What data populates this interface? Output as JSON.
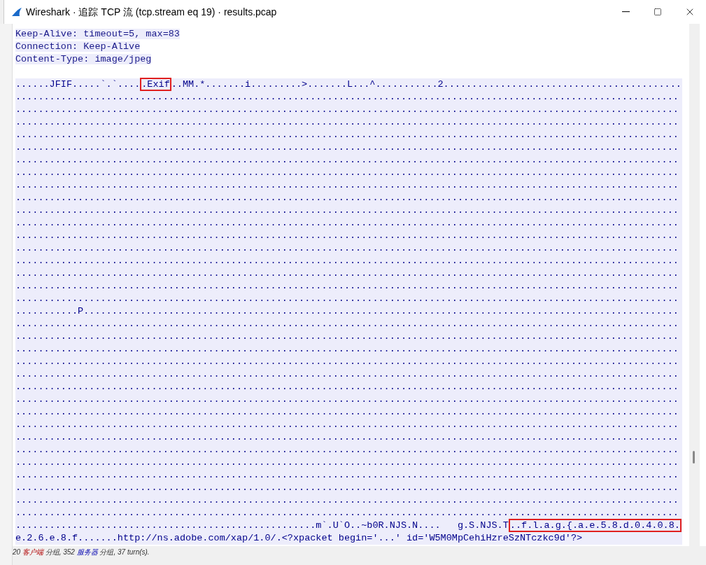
{
  "window": {
    "title": "Wireshark · 追踪 TCP 流 (tcp.stream eq 19) · results.pcap"
  },
  "header_lines": [
    "Keep-Alive: timeout=5, max=83",
    "Connection: Keep-Alive",
    "Content-Type: image/jpeg"
  ],
  "data_lines": [
    {
      "segments": [
        {
          "text": "......JFIF.....`.`....",
          "boxed": false
        },
        {
          "text": ".Exif",
          "boxed": true
        },
        {
          "text": "..MM.*.......i.........>.......L...^...........2..........................................",
          "boxed": false
        }
      ]
    },
    {
      "segments": [
        {
          "text": ".....................................................................................................................",
          "boxed": false
        }
      ]
    },
    {
      "segments": [
        {
          "text": ".....................................................................................................................",
          "boxed": false
        }
      ]
    },
    {
      "segments": [
        {
          "text": ".....................................................................................................................",
          "boxed": false
        }
      ]
    },
    {
      "segments": [
        {
          "text": ".....................................................................................................................",
          "boxed": false
        }
      ]
    },
    {
      "segments": [
        {
          "text": ".....................................................................................................................",
          "boxed": false
        }
      ]
    },
    {
      "segments": [
        {
          "text": ".....................................................................................................................",
          "boxed": false
        }
      ]
    },
    {
      "segments": [
        {
          "text": ".....................................................................................................................",
          "boxed": false
        }
      ]
    },
    {
      "segments": [
        {
          "text": ".....................................................................................................................",
          "boxed": false
        }
      ]
    },
    {
      "segments": [
        {
          "text": ".....................................................................................................................",
          "boxed": false
        }
      ]
    },
    {
      "segments": [
        {
          "text": ".....................................................................................................................",
          "boxed": false
        }
      ]
    },
    {
      "segments": [
        {
          "text": ".....................................................................................................................",
          "boxed": false
        }
      ]
    },
    {
      "segments": [
        {
          "text": ".....................................................................................................................",
          "boxed": false
        }
      ]
    },
    {
      "segments": [
        {
          "text": ".....................................................................................................................",
          "boxed": false
        }
      ]
    },
    {
      "segments": [
        {
          "text": ".....................................................................................................................",
          "boxed": false
        }
      ]
    },
    {
      "segments": [
        {
          "text": ".....................................................................................................................",
          "boxed": false
        }
      ]
    },
    {
      "segments": [
        {
          "text": ".....................................................................................................................",
          "boxed": false
        }
      ]
    },
    {
      "segments": [
        {
          "text": ".....................................................................................................................",
          "boxed": false
        }
      ]
    },
    {
      "segments": [
        {
          "text": "...........P.........................................................................................................",
          "boxed": false
        }
      ]
    },
    {
      "segments": [
        {
          "text": ".....................................................................................................................",
          "boxed": false
        }
      ]
    },
    {
      "segments": [
        {
          "text": ".....................................................................................................................",
          "boxed": false
        }
      ]
    },
    {
      "segments": [
        {
          "text": ".....................................................................................................................",
          "boxed": false
        }
      ]
    },
    {
      "segments": [
        {
          "text": ".....................................................................................................................",
          "boxed": false
        }
      ]
    },
    {
      "segments": [
        {
          "text": ".....................................................................................................................",
          "boxed": false
        }
      ]
    },
    {
      "segments": [
        {
          "text": ".....................................................................................................................",
          "boxed": false
        }
      ]
    },
    {
      "segments": [
        {
          "text": ".....................................................................................................................",
          "boxed": false
        }
      ]
    },
    {
      "segments": [
        {
          "text": ".....................................................................................................................",
          "boxed": false
        }
      ]
    },
    {
      "segments": [
        {
          "text": ".....................................................................................................................",
          "boxed": false
        }
      ]
    },
    {
      "segments": [
        {
          "text": ".....................................................................................................................",
          "boxed": false
        }
      ]
    },
    {
      "segments": [
        {
          "text": ".....................................................................................................................",
          "boxed": false
        }
      ]
    },
    {
      "segments": [
        {
          "text": ".....................................................................................................................",
          "boxed": false
        }
      ]
    },
    {
      "segments": [
        {
          "text": ".....................................................................................................................",
          "boxed": false
        }
      ]
    },
    {
      "segments": [
        {
          "text": ".....................................................................................................................",
          "boxed": false
        }
      ]
    },
    {
      "segments": [
        {
          "text": ".....................................................................................................................",
          "boxed": false
        }
      ]
    },
    {
      "segments": [
        {
          "text": ".....................................................................................................................",
          "boxed": false
        }
      ]
    },
    {
      "segments": [
        {
          "text": ".....................................................m`.U`O..~b0R.NJS.N....   g.S.NJS.T",
          "boxed": false
        },
        {
          "text": "..f.l.a.g.{.a.e.5.8.d.0.4.0.8.",
          "boxed": true
        }
      ]
    },
    {
      "segments": [
        {
          "text": "e.2.6.e.8.f.......http://ns.adobe.com/xap/1.0/.<?xpacket begin='...' id='W5M0MpCehiHzreSzNTczkc9d'?>",
          "boxed": false
        }
      ]
    }
  ],
  "status_bar": [
    {
      "text": "20 ",
      "kind": "plain"
    },
    {
      "text": "客户端",
      "kind": "client"
    },
    {
      "text": " 分组, 352 ",
      "kind": "plain"
    },
    {
      "text": "服务器",
      "kind": "server"
    },
    {
      "text": " 分组, 37 turn(s).",
      "kind": "plain"
    }
  ]
}
